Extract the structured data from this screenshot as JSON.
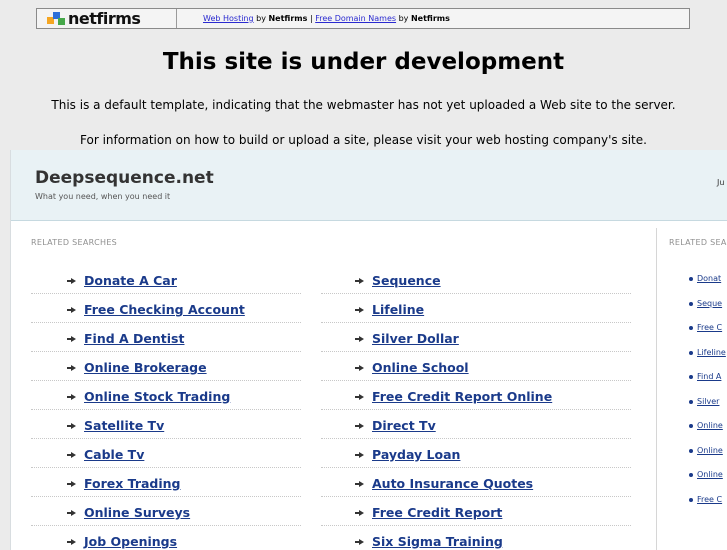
{
  "netfirms_bar": {
    "logo_text": "netfirms",
    "link1": "Web Hosting",
    "by1": " by ",
    "brand1": "Netfirms",
    "sep": " | ",
    "link2": "Free Domain Names",
    "by2": " by ",
    "brand2": "Netfirms"
  },
  "notice": {
    "title": "This site is under development",
    "line1": "This is a default template, indicating that the webmaster has not yet uploaded a Web site to the server.",
    "line2": "For information on how to build or upload a site, please visit your web hosting company's site."
  },
  "site": {
    "name": "Deepsequence.net",
    "tagline": "What you need, when you need it",
    "header_right": "Ju"
  },
  "related": {
    "label": "RELATED SEARCHES",
    "side_label": "RELATED SEA",
    "col1": [
      "Donate A Car",
      "Free Checking Account",
      "Find A Dentist",
      "Online Brokerage",
      "Online Stock Trading",
      "Satellite Tv",
      "Cable Tv",
      "Forex Trading",
      "Online Surveys",
      "Job Openings"
    ],
    "col2": [
      "Sequence",
      "Lifeline",
      "Silver Dollar",
      "Online School",
      "Free Credit Report Online",
      "Direct Tv",
      "Payday Loan",
      "Auto Insurance Quotes",
      "Free Credit Report",
      "Six Sigma Training"
    ],
    "side": [
      "Donat",
      "Seque",
      "Free C",
      "Lifeline",
      "Find A",
      "Silver",
      "Online",
      "Online",
      "Online",
      "Free C"
    ]
  }
}
